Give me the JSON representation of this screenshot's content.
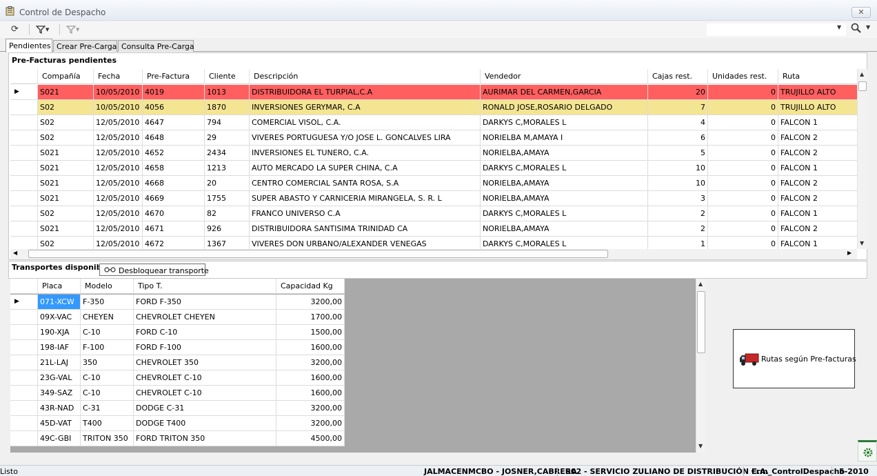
{
  "window": {
    "title": "Control de Despacho",
    "close_label": "✕"
  },
  "toolbar": {
    "refresh_icon": "refresh-icon",
    "filter_icon": "filter-icon",
    "filter_clear_icon": "filter-clear-icon",
    "search_value": ""
  },
  "tabs": [
    {
      "label": "Pendientes"
    },
    {
      "label": "Crear Pre-Carga"
    },
    {
      "label": "Consulta Pre-Carga"
    }
  ],
  "prefacturas": {
    "label": "Pre-Facturas pendientes",
    "columns": [
      "Compañía",
      "Fecha",
      "Pre-Factura",
      "Cliente",
      "Descripción",
      "Vendedor",
      "Cajas rest.",
      "Unidades rest.",
      "Ruta"
    ],
    "rows": [
      [
        "S021",
        "10/05/2010",
        "4019",
        "1013",
        "DISTRIBUIDORA EL TURPIAL,C.A",
        "AURIMAR DEL CARMEN,GARCIA",
        "20",
        "0",
        "TRUJILLO ALTO"
      ],
      [
        "S02",
        "10/05/2010",
        "4056",
        "1870",
        "INVERSIONES GERYMAR, C.A",
        "RONALD JOSE,ROSARIO DELGADO",
        "7",
        "0",
        "TRUJILLO ALTO"
      ],
      [
        "S02",
        "12/05/2010",
        "4647",
        "794",
        "COMERCIAL VISOL, C.A.",
        "DARKYS C,MORALES L",
        "4",
        "0",
        "FALCON 1"
      ],
      [
        "S02",
        "12/05/2010",
        "4648",
        "29",
        "VIVERES PORTUGUESA Y/O JOSE L. GONCALVES LIRA",
        "NORIELBA M,AMAYA I",
        "6",
        "0",
        "FALCON 2"
      ],
      [
        "S021",
        "12/05/2010",
        "4652",
        "2434",
        "INVERSIONES EL TUNERO, C.A.",
        "NORIELBA,AMAYA",
        "5",
        "0",
        "FALCON 2"
      ],
      [
        "S021",
        "12/05/2010",
        "4658",
        "1213",
        "AUTO MERCADO LA SUPER CHINA, C.A",
        "DARKYS C,MORALES L",
        "10",
        "0",
        "FALCON 1"
      ],
      [
        "S021",
        "12/05/2010",
        "4668",
        "20",
        "CENTRO COMERCIAL SANTA ROSA, S.A",
        "NORIELBA,AMAYA",
        "10",
        "0",
        "FALCON 2"
      ],
      [
        "S021",
        "12/05/2010",
        "4669",
        "1755",
        "SUPER ABASTO Y CARNICERIA MIRANGELA, S. R. L",
        "NORIELBA,AMAYA",
        "3",
        "0",
        "FALCON 2"
      ],
      [
        "S02",
        "12/05/2010",
        "4670",
        "82",
        "FRANCO UNIVERSO C.A",
        "DARKYS C,MORALES L",
        "2",
        "0",
        "FALCON 1"
      ],
      [
        "S021",
        "12/05/2010",
        "4671",
        "926",
        "DISTRIBUIDORA SANTISIMA TRINIDAD CA",
        "NORIELBA,AMAYA",
        "2",
        "0",
        "FALCON 2"
      ],
      [
        "S02",
        "12/05/2010",
        "4672",
        "1367",
        "VIVERES DON URBANO/ALEXANDER VENEGAS",
        "DARKYS C,MORALES L",
        "1",
        "0",
        "FALCON 1"
      ]
    ],
    "row_colors": {
      "0": "#ff5f5f",
      "1": "#f4e593"
    }
  },
  "transportes": {
    "label": "Transportes disponibles",
    "unlock_button": "Desbloquear transporte",
    "columns": [
      "Placa",
      "Modelo",
      "Tipo T.",
      "Capacidad Kg"
    ],
    "rows": [
      [
        "071-XCW",
        "F-350",
        "FORD F-350",
        "3200,00"
      ],
      [
        "09X-VAC",
        "CHEYEN",
        "CHEVROLET CHEYEN",
        "1700,00"
      ],
      [
        "190-XJA",
        "C-10",
        "FORD C-10",
        "1500,00"
      ],
      [
        "198-IAF",
        "F-100",
        "FORD F-100",
        "1600,00"
      ],
      [
        "21L-LAJ",
        "350",
        "CHEVROLET 350",
        "3200,00"
      ],
      [
        "23G-VAL",
        "C-10",
        "CHEVROLET C-10",
        "1600,00"
      ],
      [
        "349-SAZ",
        "C-10",
        "CHEVROLET C-10",
        "1600,00"
      ],
      [
        "43R-NAD",
        "C-31",
        "DODGE C-31",
        "3200,00"
      ],
      [
        "45D-VAT",
        "T400",
        "DODGE T400",
        "3200,00"
      ],
      [
        "49C-GBI",
        "TRITON 350",
        "FORD TRITON 350",
        "4500,00"
      ]
    ]
  },
  "rutas_button": "Rutas según Pre-facturas",
  "status": {
    "left": "Listo",
    "user": "JALMACENMCBO - JOSNER,CABRERA",
    "company": "S02 - SERVICIO ZULIANO DE DISTRIBUCIÓN C.A.",
    "form": "Frm_ControlDespacho",
    "period": "5-2010"
  }
}
